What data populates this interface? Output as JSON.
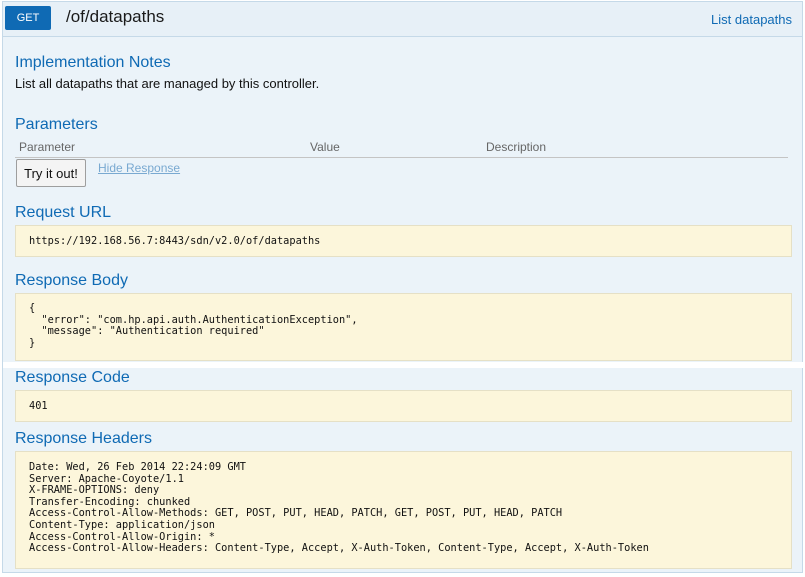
{
  "endpoint": {
    "method": "GET",
    "path": "/of/datapaths",
    "list_link": "List datapaths"
  },
  "implementation_notes": {
    "heading": "Implementation Notes",
    "text": "List all datapaths that are managed by this controller."
  },
  "parameters": {
    "heading": "Parameters",
    "columns": [
      "Parameter",
      "Value",
      "Description"
    ],
    "try_button": "Try it out!",
    "hide_response": "Hide Response"
  },
  "request_url": {
    "heading": "Request URL",
    "value": "https://192.168.56.7:8443/sdn/v2.0/of/datapaths"
  },
  "response_body": {
    "heading": "Response Body",
    "lines": [
      "{",
      "  \"error\": \"com.hp.api.auth.AuthenticationException\",",
      "  \"message\": \"Authentication required\"",
      "}"
    ]
  },
  "response_code": {
    "heading": "Response Code",
    "value": "401"
  },
  "response_headers": {
    "heading": "Response Headers",
    "lines": [
      "Date: Wed, 26 Feb 2014 22:24:09 GMT",
      "Server: Apache-Coyote/1.1",
      "X-FRAME-OPTIONS: deny",
      "Transfer-Encoding: chunked",
      "Access-Control-Allow-Methods: GET, POST, PUT, HEAD, PATCH, GET, POST, PUT, HEAD, PATCH",
      "Content-Type: application/json",
      "Access-Control-Allow-Origin: *",
      "Access-Control-Allow-Headers: Content-Type, Accept, X-Auth-Token, Content-Type, Accept, X-Auth-Token"
    ]
  },
  "colors": {
    "accent": "#0f6ab4",
    "panel_bg": "#ebf3f9",
    "code_bg": "#fcf6db"
  }
}
